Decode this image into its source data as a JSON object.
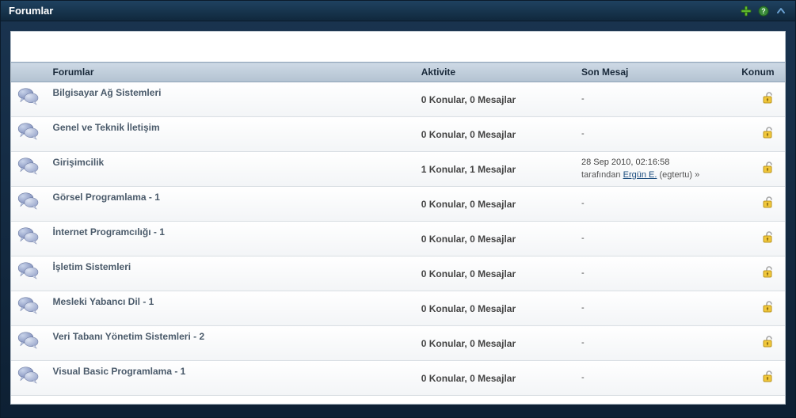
{
  "header": {
    "title": "Forumlar"
  },
  "columns": {
    "forum": "Forumlar",
    "activity": "Aktivite",
    "last": "Son Mesaj",
    "status": "Konum"
  },
  "lastText": {
    "by": "tarafından"
  },
  "forums": [
    {
      "name": "Bilgisayar Ağ Sistemleri",
      "activity": "0 Konular, 0 Mesajlar",
      "lastDate": "-",
      "lastBy": "",
      "lastHandle": ""
    },
    {
      "name": "Genel ve Teknik İletişim",
      "activity": "0 Konular, 0 Mesajlar",
      "lastDate": "-",
      "lastBy": "",
      "lastHandle": ""
    },
    {
      "name": "Girişimcilik",
      "activity": "1 Konular, 1 Mesajlar",
      "lastDate": "28 Sep 2010, 02:16:58",
      "lastBy": "Ergün E.",
      "lastHandle": "(egtertu) »"
    },
    {
      "name": "Görsel Programlama - 1",
      "activity": "0 Konular, 0 Mesajlar",
      "lastDate": "-",
      "lastBy": "",
      "lastHandle": ""
    },
    {
      "name": "İnternet Programcılığı - 1",
      "activity": "0 Konular, 0 Mesajlar",
      "lastDate": "-",
      "lastBy": "",
      "lastHandle": ""
    },
    {
      "name": "İşletim Sistemleri",
      "activity": "0 Konular, 0 Mesajlar",
      "lastDate": "-",
      "lastBy": "",
      "lastHandle": ""
    },
    {
      "name": "Mesleki Yabancı Dil - 1",
      "activity": "0 Konular, 0 Mesajlar",
      "lastDate": "-",
      "lastBy": "",
      "lastHandle": ""
    },
    {
      "name": "Veri Tabanı Yönetim Sistemleri - 2",
      "activity": "0 Konular, 0 Mesajlar",
      "lastDate": "-",
      "lastBy": "",
      "lastHandle": ""
    },
    {
      "name": "Visual Basic Programlama - 1",
      "activity": "0 Konular, 0 Mesajlar",
      "lastDate": "-",
      "lastBy": "",
      "lastHandle": ""
    }
  ]
}
